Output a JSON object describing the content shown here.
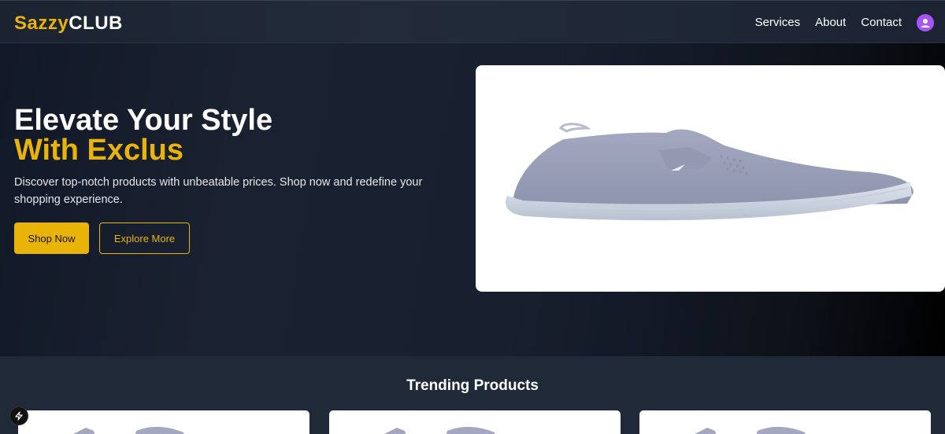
{
  "nav": {
    "logo_primary": "Sazzy",
    "logo_secondary": "CLUB",
    "links": [
      "Services",
      "About",
      "Contact"
    ],
    "avatar_icon": "user-icon"
  },
  "hero": {
    "title_line1": "Elevate Your Style",
    "title_line2": "With Exclus",
    "description": "Discover top-notch products with unbeatable prices. Shop now and redefine your shopping experience.",
    "primary_button": "Shop Now",
    "secondary_button": "Explore More",
    "image_icon": "shoe-image"
  },
  "trending": {
    "title": "Trending Products"
  },
  "colors": {
    "accent": "#eab308",
    "avatar": "#a855f7",
    "background": "#1f2937"
  }
}
